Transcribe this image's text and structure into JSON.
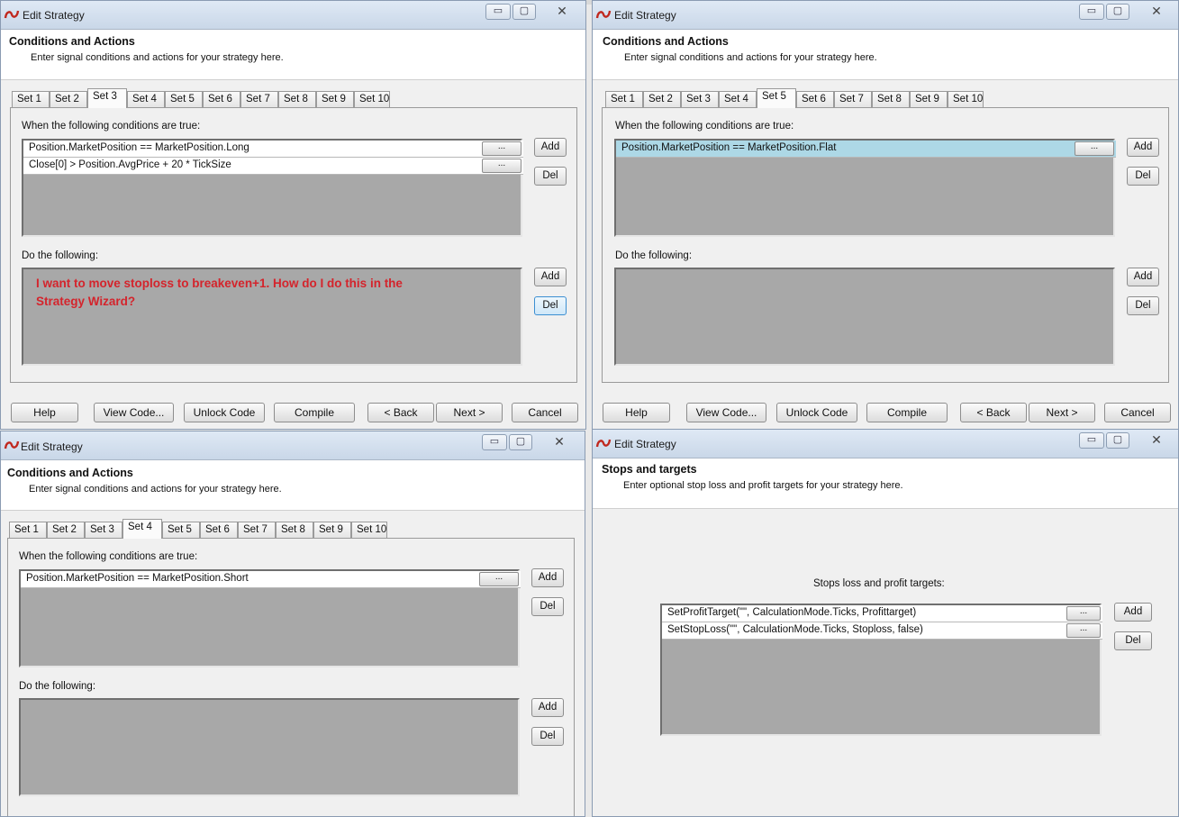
{
  "windows": [
    {
      "title": "Edit Strategy",
      "header": {
        "title": "Conditions and Actions",
        "subtitle": "Enter signal conditions and actions for your strategy here."
      },
      "tabs": [
        "Set 1",
        "Set 2",
        "Set 3",
        "Set 4",
        "Set 5",
        "Set 6",
        "Set 7",
        "Set 8",
        "Set 9",
        "Set 10"
      ],
      "active_tab": "Set 3",
      "conditions_label": "When the following conditions are true:",
      "conditions": [
        "Position.MarketPosition == MarketPosition.Long",
        "Close[0] > Position.AvgPrice + 20 * TickSize"
      ],
      "actions_label": "Do the following:",
      "annotation": "I want to move stoploss to breakeven+1. How do I do this in the Strategy Wizard?",
      "add_label": "Add",
      "del_label": "Del",
      "ellipsis_label": "...",
      "buttons": [
        "Help",
        "View Code...",
        "Unlock Code",
        "Compile",
        "< Back",
        "Next >",
        "Cancel"
      ]
    },
    {
      "title": "Edit Strategy",
      "header": {
        "title": "Conditions and Actions",
        "subtitle": "Enter signal conditions and actions for your strategy here."
      },
      "tabs": [
        "Set 1",
        "Set 2",
        "Set 3",
        "Set 4",
        "Set 5",
        "Set 6",
        "Set 7",
        "Set 8",
        "Set 9",
        "Set 10"
      ],
      "active_tab": "Set 5",
      "conditions_label": "When the following conditions are true:",
      "conditions": [
        "Position.MarketPosition == MarketPosition.Flat"
      ],
      "actions_label": "Do the following:",
      "add_label": "Add",
      "del_label": "Del",
      "ellipsis_label": "...",
      "buttons": [
        "Help",
        "View Code...",
        "Unlock Code",
        "Compile",
        "< Back",
        "Next >",
        "Cancel"
      ]
    },
    {
      "title": "Edit Strategy",
      "header": {
        "title": "Conditions and Actions",
        "subtitle": "Enter signal conditions and actions for your strategy here."
      },
      "tabs": [
        "Set 1",
        "Set 2",
        "Set 3",
        "Set 4",
        "Set 5",
        "Set 6",
        "Set 7",
        "Set 8",
        "Set 9",
        "Set 10"
      ],
      "active_tab": "Set 4",
      "conditions_label": "When the following conditions are true:",
      "conditions": [
        "Position.MarketPosition == MarketPosition.Short"
      ],
      "actions_label": "Do the following:",
      "add_label": "Add",
      "del_label": "Del",
      "ellipsis_label": "..."
    },
    {
      "title": "Edit Strategy",
      "header": {
        "title": "Stops and targets",
        "subtitle": "Enter optional stop loss and profit targets for your strategy here."
      },
      "stops_label": "Stops loss and profit targets:",
      "stops": [
        "SetProfitTarget(\"\", CalculationMode.Ticks, Profittarget)",
        "SetStopLoss(\"\", CalculationMode.Ticks, Stoploss, false)"
      ],
      "add_label": "Add",
      "del_label": "Del",
      "ellipsis_label": "..."
    }
  ],
  "caption_buttons": {
    "minimize": "▭",
    "maximize": "▢",
    "close": "✕"
  },
  "colors": {
    "annotation": "#d4242c",
    "selected_row": "#add8e6",
    "list_bg": "#a8a8a8"
  }
}
